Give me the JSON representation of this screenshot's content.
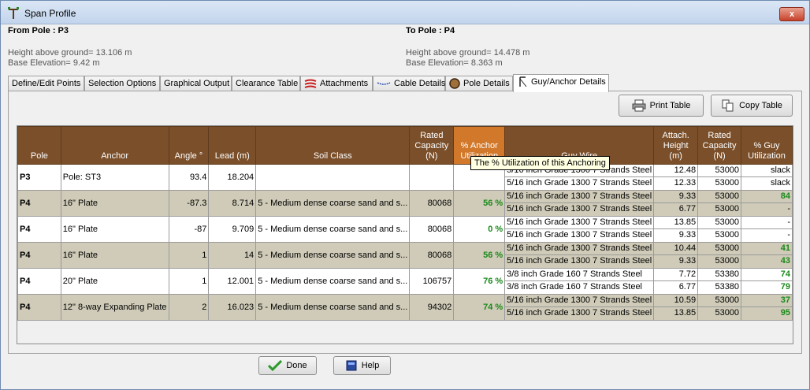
{
  "window": {
    "title": "Span Profile",
    "close": "x"
  },
  "from_pole": {
    "header": "From Pole : P3",
    "height": "Height above ground= 13.106 m",
    "base": "Base Elevation= 9.42 m"
  },
  "to_pole": {
    "header": "To Pole : P4",
    "height": "Height above ground= 14.478 m",
    "base": "Base Elevation= 8.363 m"
  },
  "tabs": [
    {
      "label": "Define/Edit Points"
    },
    {
      "label": "Selection Options"
    },
    {
      "label": "Graphical Output"
    },
    {
      "label": "Clearance Table"
    },
    {
      "label": "Attachments",
      "icon": "attachments-icon"
    },
    {
      "label": "Cable Details",
      "icon": "cable-icon"
    },
    {
      "label": "Pole Details",
      "icon": "pole-icon"
    },
    {
      "label": "Guy/Anchor Details",
      "icon": "guy-anchor-icon"
    }
  ],
  "toolbar": {
    "print": "Print Table",
    "copy": "Copy Table"
  },
  "table": {
    "headers": [
      "Pole",
      "Anchor",
      "Angle °",
      "Lead (m)",
      "Soil Class",
      "Rated Capacity (N)",
      "% Anchor Utilization",
      "Guy Wire",
      "Attach. Height (m)",
      "Rated Capacity (N)",
      "% Guy Utilization"
    ],
    "rows": [
      {
        "pole": "P3",
        "anchor": "Pole: ST3",
        "angle": "93.4",
        "lead": "18.204",
        "soil": "",
        "cap": "",
        "util": "",
        "guys": [
          {
            "wire": "5/16 inch Grade 1300 7 Strands  Steel",
            "h": "12.48",
            "c": "53000",
            "u": "slack"
          },
          {
            "wire": "5/16 inch Grade 1300 7 Strands  Steel",
            "h": "12.33",
            "c": "53000",
            "u": "slack"
          }
        ]
      },
      {
        "pole": "P4",
        "anchor": "16\" Plate",
        "angle": "-87.3",
        "lead": "8.714",
        "soil": "5 - Medium dense coarse sand and s...",
        "cap": "80068",
        "util": "56 %",
        "guys": [
          {
            "wire": "5/16 inch Grade 1300 7 Strands  Steel",
            "h": "9.33",
            "c": "53000",
            "u": "84"
          },
          {
            "wire": "5/16 inch Grade 1300 7 Strands  Steel",
            "h": "6.77",
            "c": "53000",
            "u": "-"
          }
        ]
      },
      {
        "pole": "P4",
        "anchor": "16\" Plate",
        "angle": "-87",
        "lead": "9.709",
        "soil": "5 - Medium dense coarse sand and s...",
        "cap": "80068",
        "util": "0 %",
        "guys": [
          {
            "wire": "5/16 inch Grade 1300 7 Strands  Steel",
            "h": "13.85",
            "c": "53000",
            "u": "-"
          },
          {
            "wire": "5/16 inch Grade 1300 7 Strands  Steel",
            "h": "9.33",
            "c": "53000",
            "u": "-"
          }
        ]
      },
      {
        "pole": "P4",
        "anchor": "16\" Plate",
        "angle": "1",
        "lead": "14",
        "soil": "5 - Medium dense coarse sand and s...",
        "cap": "80068",
        "util": "56 %",
        "guys": [
          {
            "wire": "5/16 inch Grade 1300 7 Strands  Steel",
            "h": "10.44",
            "c": "53000",
            "u": "41"
          },
          {
            "wire": "5/16 inch Grade 1300 7 Strands  Steel",
            "h": "9.33",
            "c": "53000",
            "u": "43"
          }
        ]
      },
      {
        "pole": "P4",
        "anchor": "20\" Plate",
        "angle": "1",
        "lead": "12.001",
        "soil": "5 - Medium dense coarse sand and s...",
        "cap": "106757",
        "util": "76 %",
        "guys": [
          {
            "wire": "3/8 inch Grade 160 7 Strands  Steel",
            "h": "7.72",
            "c": "53380",
            "u": "74"
          },
          {
            "wire": "3/8 inch Grade 160 7 Strands  Steel",
            "h": "6.77",
            "c": "53380",
            "u": "79"
          }
        ]
      },
      {
        "pole": "P4",
        "anchor": "12\" 8-way Expanding Plate",
        "angle": "2",
        "lead": "16.023",
        "soil": "5 - Medium dense coarse sand and s...",
        "cap": "94302",
        "util": "74 %",
        "guys": [
          {
            "wire": "5/16 inch Grade 1300 7 Strands  Steel",
            "h": "10.59",
            "c": "53000",
            "u": "37"
          },
          {
            "wire": "5/16 inch Grade 1300 7 Strands  Steel",
            "h": "13.85",
            "c": "53000",
            "u": "95"
          }
        ]
      }
    ]
  },
  "tooltip": "The % Utilization of this Anchoring",
  "footer": {
    "done": "Done",
    "help": "Help"
  },
  "colors": {
    "header": "#7a4f2a",
    "header_highlight": "#d2782a",
    "util_green": "#1a8a1a",
    "row_alt": "#cfcbb8"
  }
}
